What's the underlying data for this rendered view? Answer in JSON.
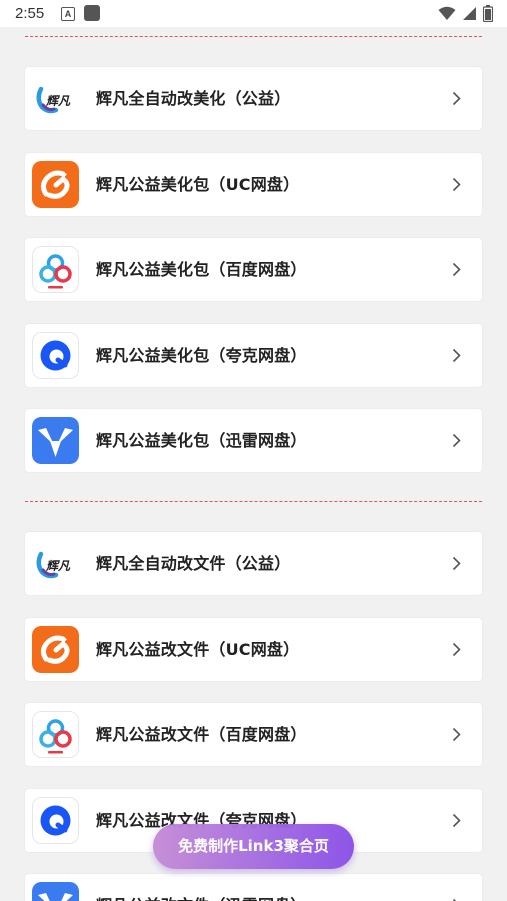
{
  "status_bar": {
    "time": "2:55",
    "notification_letter": "A",
    "icons": [
      "wifi-icon",
      "signal-icon",
      "battery-icon"
    ]
  },
  "sections": [
    {
      "items": [
        {
          "label": "辉凡全自动改美化（公益）",
          "icon": "huifan-logo-icon",
          "logo_text": "辉凡"
        },
        {
          "label": "辉凡公益美化包（UC网盘）",
          "icon": "uc-drive-icon"
        },
        {
          "label": "辉凡公益美化包（百度网盘）",
          "icon": "baidu-drive-icon"
        },
        {
          "label": "辉凡公益美化包（夸克网盘）",
          "icon": "quark-drive-icon"
        },
        {
          "label": "辉凡公益美化包（迅雷网盘）",
          "icon": "xunlei-drive-icon"
        }
      ]
    },
    {
      "items": [
        {
          "label": "辉凡全自动改文件（公益）",
          "icon": "huifan-logo-icon",
          "logo_text": "辉凡"
        },
        {
          "label": "辉凡公益改文件（UC网盘）",
          "icon": "uc-drive-icon"
        },
        {
          "label": "辉凡公益改文件（百度网盘）",
          "icon": "baidu-drive-icon"
        },
        {
          "label": "辉凡公益改文件（夸克网盘）",
          "icon": "quark-drive-icon"
        },
        {
          "label": "辉凡公益改文件（迅雷网盘）",
          "icon": "xunlei-drive-icon"
        }
      ]
    }
  ],
  "fab": {
    "label": "免费制作Link3聚合页"
  },
  "colors": {
    "divider": "#e55353",
    "uc": "#f26c1a",
    "baidu_blue": "#2aa3e8",
    "baidu_red": "#e8384a",
    "quark": "#1a55f5",
    "xunlei": "#3a7bf0",
    "fab_start": "#c58bd6",
    "fab_end": "#8a4fe8"
  }
}
